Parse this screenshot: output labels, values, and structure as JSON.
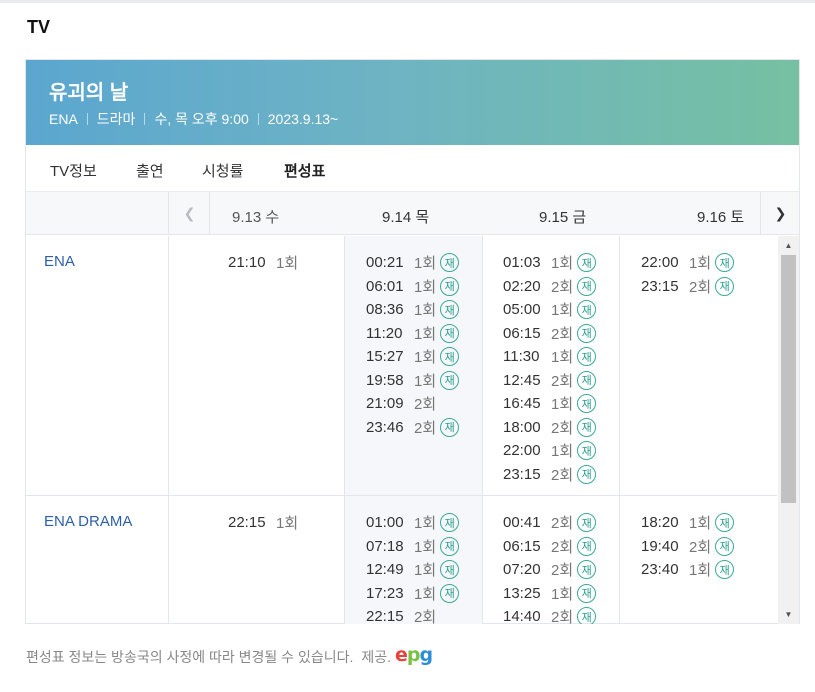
{
  "section_title": "TV",
  "show": {
    "title": "유괴의 날",
    "meta": [
      "ENA",
      "드라마",
      "수, 목 오후 9:00",
      "2023.9.13~"
    ]
  },
  "tabs": [
    {
      "label": "TV정보",
      "active": false
    },
    {
      "label": "출연",
      "active": false
    },
    {
      "label": "시청률",
      "active": false
    },
    {
      "label": "편성표",
      "active": true
    }
  ],
  "dates": [
    "9.13 수",
    "9.14 목",
    "9.15 금",
    "9.16 토"
  ],
  "rerun_label": "재",
  "schedule": [
    {
      "channel": "ENA",
      "days": [
        [
          {
            "time": "21:10",
            "ep": "1회",
            "rerun": false
          }
        ],
        [
          {
            "time": "00:21",
            "ep": "1회",
            "rerun": true
          },
          {
            "time": "06:01",
            "ep": "1회",
            "rerun": true
          },
          {
            "time": "08:36",
            "ep": "1회",
            "rerun": true
          },
          {
            "time": "11:20",
            "ep": "1회",
            "rerun": true
          },
          {
            "time": "15:27",
            "ep": "1회",
            "rerun": true
          },
          {
            "time": "19:58",
            "ep": "1회",
            "rerun": true
          },
          {
            "time": "21:09",
            "ep": "2회",
            "rerun": false
          },
          {
            "time": "23:46",
            "ep": "2회",
            "rerun": true
          }
        ],
        [
          {
            "time": "01:03",
            "ep": "1회",
            "rerun": true
          },
          {
            "time": "02:20",
            "ep": "2회",
            "rerun": true
          },
          {
            "time": "05:00",
            "ep": "1회",
            "rerun": true
          },
          {
            "time": "06:15",
            "ep": "2회",
            "rerun": true
          },
          {
            "time": "11:30",
            "ep": "1회",
            "rerun": true
          },
          {
            "time": "12:45",
            "ep": "2회",
            "rerun": true
          },
          {
            "time": "16:45",
            "ep": "1회",
            "rerun": true
          },
          {
            "time": "18:00",
            "ep": "2회",
            "rerun": true
          },
          {
            "time": "22:00",
            "ep": "1회",
            "rerun": true
          },
          {
            "time": "23:15",
            "ep": "2회",
            "rerun": true
          }
        ],
        [
          {
            "time": "22:00",
            "ep": "1회",
            "rerun": true
          },
          {
            "time": "23:15",
            "ep": "2회",
            "rerun": true
          }
        ]
      ]
    },
    {
      "channel": "ENA DRAMA",
      "days": [
        [
          {
            "time": "22:15",
            "ep": "1회",
            "rerun": false
          }
        ],
        [
          {
            "time": "01:00",
            "ep": "1회",
            "rerun": true
          },
          {
            "time": "07:18",
            "ep": "1회",
            "rerun": true
          },
          {
            "time": "12:49",
            "ep": "1회",
            "rerun": true
          },
          {
            "time": "17:23",
            "ep": "1회",
            "rerun": true
          },
          {
            "time": "22:15",
            "ep": "2회",
            "rerun": false
          }
        ],
        [
          {
            "time": "00:41",
            "ep": "2회",
            "rerun": true
          },
          {
            "time": "06:15",
            "ep": "2회",
            "rerun": true
          },
          {
            "time": "07:20",
            "ep": "2회",
            "rerun": true
          },
          {
            "time": "13:25",
            "ep": "1회",
            "rerun": true
          },
          {
            "time": "14:40",
            "ep": "2회",
            "rerun": true
          }
        ],
        [
          {
            "time": "18:20",
            "ep": "1회",
            "rerun": true
          },
          {
            "time": "19:40",
            "ep": "2회",
            "rerun": true
          },
          {
            "time": "23:40",
            "ep": "1회",
            "rerun": true
          }
        ]
      ]
    }
  ],
  "footer": {
    "notice": "편성표 정보는 방송국의 사정에 따라 변경될 수 있습니다.",
    "provider_label": "제공."
  },
  "colors": {
    "accent": "#2a9d8f",
    "channel_link": "#2d5fa8",
    "banner_start": "#5ba6cf",
    "banner_end": "#76c0a2"
  }
}
